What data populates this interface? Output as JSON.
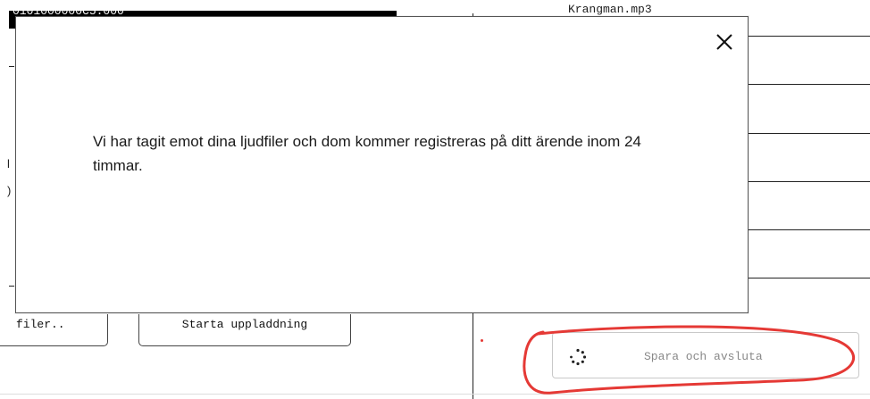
{
  "background": {
    "top_left_text": "0101000000C5.000",
    "top_right_file": "Krangman.mp3",
    "choose_files_label": "filer..",
    "start_upload_label": "Starta uppladdning",
    "save_exit_label": "Spara och avsluta",
    "edge_glyphs": [
      "l",
      ")"
    ]
  },
  "modal": {
    "message": "Vi har tagit emot dina ljudfiler och dom kommer registreras på ditt ärende inom 24 timmar."
  },
  "colors": {
    "annotation": "#e53935",
    "border": "#555555",
    "muted_text": "#888888"
  },
  "icons": {
    "close": "close-icon",
    "spinner": "loading-spinner-icon"
  }
}
